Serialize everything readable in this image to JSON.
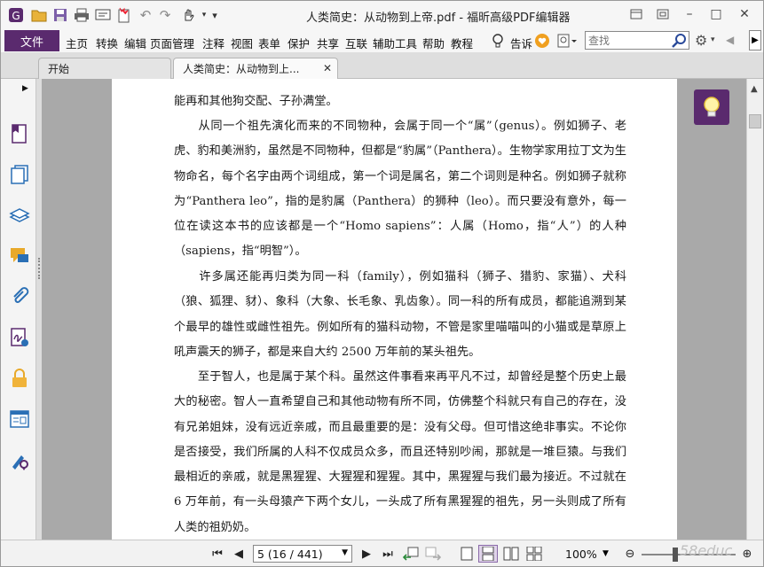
{
  "window": {
    "title": "人类简史：从动物到上帝.pdf - 福昕高级PDF编辑器"
  },
  "menu": {
    "file": "文件",
    "items": [
      "主页",
      "转换",
      "编辑",
      "页面管理",
      "注释",
      "视图",
      "表单",
      "保护",
      "共享",
      "互联",
      "辅助工具",
      "帮助",
      "教程"
    ],
    "tell_me": "告诉",
    "search_placeholder": "查找"
  },
  "tabs": {
    "start": "开始",
    "document": "人类简史：从动物到上..."
  },
  "document": {
    "paragraphs": [
      "能再和其他狗交配、子孙满堂。",
      "　　从同一个祖先演化而来的不同物种，会属于同一个“属”（genus）。例如狮子、老虎、豹和美洲豹，虽然是不同物种，但都是“豹属”（Panthera）。生物学家用拉丁文为生物命名，每个名字由两个词组成，第一个词是属名，第二个词则是种名。例如狮子就称为“Panthera leo”，指的是豹属（Panthera）的狮种（leo）。而只要没有意外，每一位在读这本书的应该都是一个“Homo sapiens”：人属（Homo，指“人”）的人种（sapiens，指“明智”）。",
      "　　许多属还能再归类为同一科（family），例如猫科（狮子、猎豹、家猫）、犬科（狼、狐狸、豺）、象科（大象、长毛象、乳齿象）。同一科的所有成员，都能追溯到某个最早的雄性或雌性祖先。例如所有的猫科动物，不管是家里喵喵叫的小猫或是草原上吼声震天的狮子，都是来自大约 2500 万年前的某头祖先。",
      "　　至于智人，也是属于某个科。虽然这件事看来再平凡不过，却曾经是整个历史上最大的秘密。智人一直希望自己和其他动物有所不同，仿佛整个科就只有自己的存在，没有兄弟姐妹，没有远近亲戚，而且最重要的是：没有父母。但可惜这绝非事实。不论你是否接受，我们所属的人科不仅成员众多，而且还特别吵闹，那就是一堆巨猿。与我们最相近的亲戚，就是黑猩猩、大猩猩和猩猩。其中，黑猩猩与我们最为接近。不过就在 6 万年前，有一头母猿产下两个女儿，一头成了所有黑猩猩的祖先，另一头则成了所有人类的祖奶奶。"
    ]
  },
  "status": {
    "page_display": "5 (16 / 441)",
    "zoom": "100%",
    "zoom_level_percent": 36
  },
  "watermark": "58educ",
  "colors": {
    "accent": "#5a2a6e",
    "page_background": "#a9a9a9"
  }
}
